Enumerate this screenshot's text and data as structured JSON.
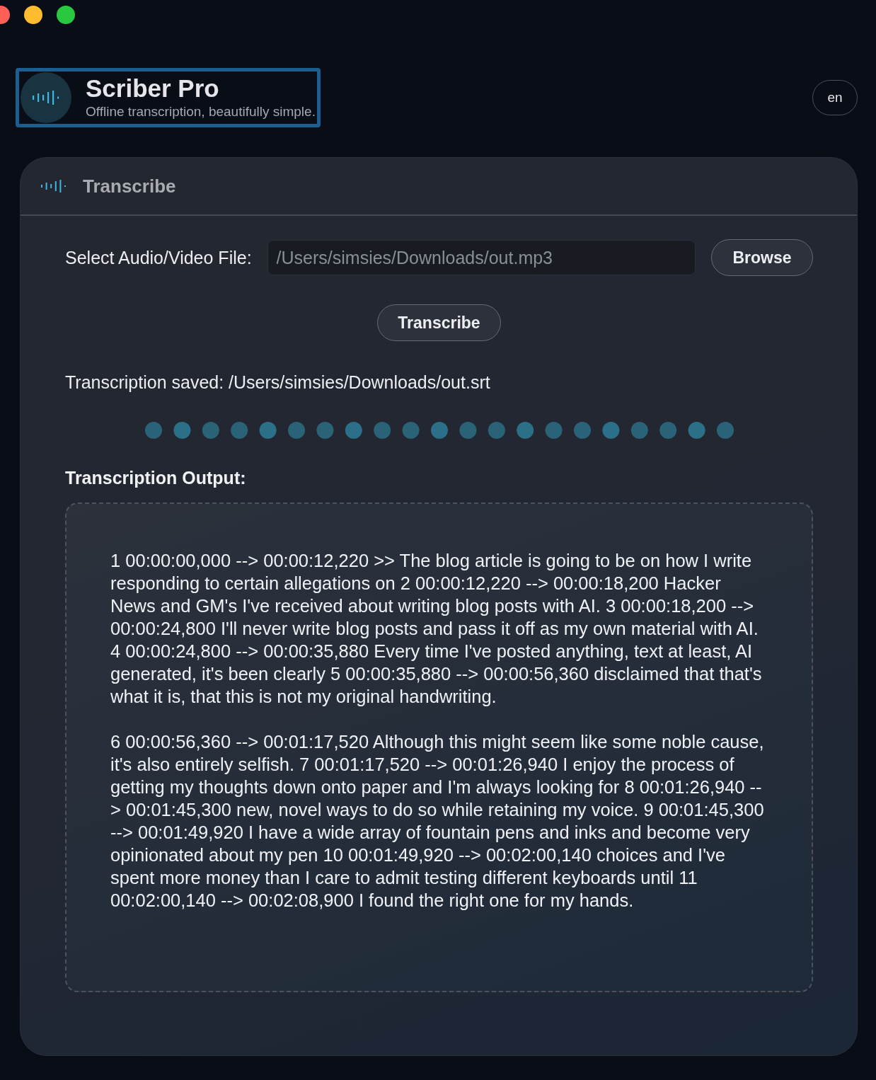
{
  "app": {
    "title": "Scriber Pro",
    "tagline": "Offline transcription, beautifully simple."
  },
  "language_button": "en",
  "panel": {
    "title": "Transcribe",
    "file_label": "Select Audio/Video File:",
    "file_path": "/Users/simsies/Downloads/out.mp3",
    "browse_button": "Browse",
    "transcribe_button": "Transcribe",
    "status": "Transcription saved: /Users/simsies/Downloads/out.srt",
    "output_heading": "Transcription Output:",
    "output_paragraphs": [
      "1 00:00:00,000 --> 00:00:12,220 >> The blog article is going to be on how I write responding to certain allegations on 2 00:00:12,220 --> 00:00:18,200 Hacker News and GM's I've received about writing blog posts with AI. 3 00:00:18,200 --> 00:00:24,800 I'll never write blog posts and pass it off as my own material with AI. 4 00:00:24,800 --> 00:00:35,880 Every time I've posted anything, text at least, AI generated, it's been clearly 5 00:00:35,880 --> 00:00:56,360 disclaimed that that's what it is, that this is not my original handwriting.",
      "6 00:00:56,360 --> 00:01:17,520 Although this might seem like some noble cause, it's also entirely selfish. 7 00:01:17,520 --> 00:01:26,940 I enjoy the process of getting my thoughts down onto paper and I'm always looking for 8 00:01:26,940 --> 00:01:45,300 new, novel ways to do so while retaining my voice. 9 00:01:45,300 --> 00:01:49,920 I have a wide array of fountain pens and inks and become very opinionated about my pen 10 00:01:49,920 --> 00:02:00,140 choices and I've spent more money than I care to admit testing different keyboards until 11 00:02:00,140 --> 00:02:08,900 I found the right one for my hands."
    ]
  }
}
